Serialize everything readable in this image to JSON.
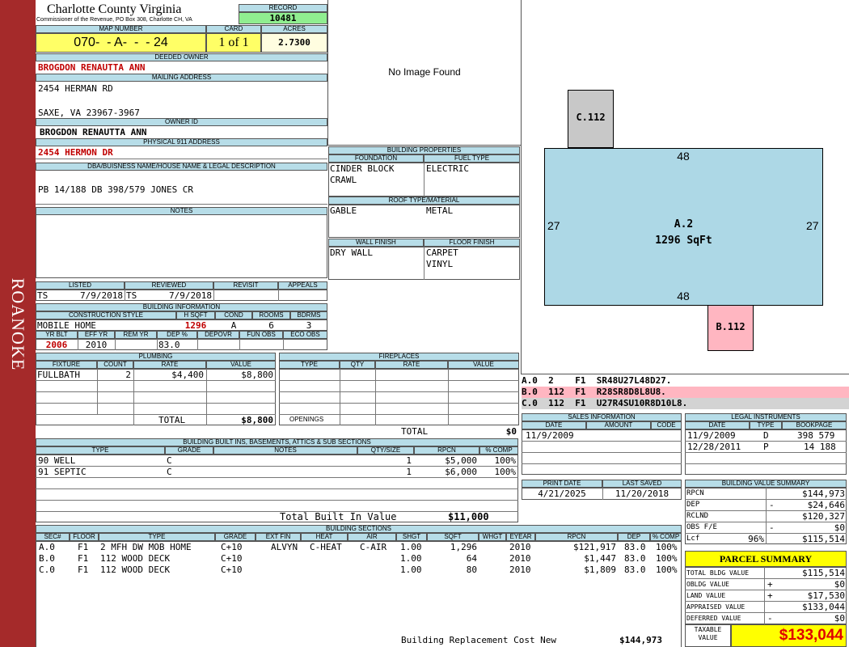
{
  "sidebar": {
    "label": "ROANOKE",
    "color": "#a52a2a"
  },
  "header": {
    "county": "Charlotte County Virginia",
    "commissioner": "Commissioner of the Revenue, PO Box 308, Charlotte CH, VA",
    "record_label": "RECORD",
    "record": "10481",
    "map_number_label": "MAP NUMBER",
    "map_number": "070-  - A-  -  - 24",
    "card_label": "CARD",
    "card": "1 of 1",
    "acres_label": "ACRES",
    "acres": "2.7300"
  },
  "owner": {
    "deeded_label": "DEEDED OWNER",
    "deeded": "BROGDON RENAUTTA ANN",
    "mailing_label": "MAILING ADDRESS",
    "mailing1": "2454 HERMAN RD",
    "mailing2": "SAXE, VA 23967-3967",
    "owner_id_label": "OWNER ID",
    "owner_id": "BROGDON RENAUTTA ANN",
    "physical_label": "PHYSICAL 911 ADDRESS",
    "physical": "2454 HERMON DR",
    "dba_label": "DBA/BUISNESS NAME/HOUSE NAME & LEGAL DESCRIPTION",
    "legal": "PB 14/188 DB 398/579 JONES CR",
    "notes_label": "NOTES"
  },
  "photo": {
    "text": "No Image Found"
  },
  "listing": {
    "listed_label": "LISTED",
    "reviewed_label": "REVIEWED",
    "revisit_label": "REVISIT",
    "appeals_label": "APPEALS",
    "listed_by": "TS",
    "listed_date": "7/9/2018",
    "reviewed_by": "TS",
    "reviewed_date": "7/9/2018"
  },
  "building_info": {
    "label": "BUILDING INFORMATION",
    "style_label": "CONSTRUCTION STYLE",
    "hsqft_label": "H SQFT",
    "cond_label": "COND",
    "rooms_label": "ROOMS",
    "bdrms_label": "BDRMS",
    "style": "MOBILE HOME",
    "hsqft": "1296",
    "cond": "A",
    "rooms": "6",
    "bdrms": "3",
    "yrblt_label": "YR BLT",
    "effyr_label": "EFF YR",
    "remyr_label": "REM YR",
    "dep_label": "DEP %",
    "depovr_label": "DEPOVR",
    "funobs_label": "FUN OBS",
    "ecoobs_label": "ECO OBS",
    "yrblt": "2006",
    "effyr": "2010",
    "dep": "83.0"
  },
  "properties": {
    "label": "BUILDING PROPERTIES",
    "foundation_label": "FOUNDATION",
    "fuel_label": "FUEL TYPE",
    "foundation1": "CINDER BLOCK",
    "foundation2": "CRAWL",
    "fuel": "ELECTRIC",
    "roof_label": "ROOF TYPE/MATERIAL",
    "roof_type": "GABLE",
    "roof_material": "METAL",
    "wall_label": "WALL FINISH",
    "floor_label": "FLOOR FINISH",
    "wall": "DRY WALL",
    "floor1": "CARPET",
    "floor2": "VINYL"
  },
  "plumbing": {
    "label": "PLUMBING",
    "headers": [
      "FIXTURE",
      "COUNT",
      "RATE",
      "VALUE"
    ],
    "rows": [
      {
        "fixture": "FULLBATH",
        "count": "2",
        "rate": "$4,400",
        "value": "$8,800"
      }
    ],
    "total_label": "TOTAL",
    "total": "$8,800"
  },
  "fireplaces": {
    "label": "FIREPLACES",
    "headers": [
      "TYPE",
      "QTY",
      "RATE",
      "VALUE"
    ],
    "openings_label": "OPENINGS",
    "total_label": "TOTAL",
    "total": "$0"
  },
  "builtins": {
    "label": "BUILDING BUILT INS, BASEMENTS, ATTICS & SUB SECTIONS",
    "headers": [
      "TYPE",
      "GRADE",
      "NOTES",
      "QTY/SIZE",
      "RPCN",
      "% COMP"
    ],
    "rows": [
      {
        "type": "90 WELL",
        "grade": "C",
        "notes": "",
        "qty": "1",
        "rpcn": "$5,000",
        "comp": "100%"
      },
      {
        "type": "91 SEPTIC",
        "grade": "C",
        "notes": "",
        "qty": "1",
        "rpcn": "$6,000",
        "comp": "100%"
      }
    ],
    "total_label": "Total Built In Value",
    "total": "$11,000"
  },
  "sections": {
    "label": "BUILDING SECTIONS",
    "headers": [
      "SEC#",
      "FLOOR",
      "TYPE",
      "GRADE",
      "EXT FIN",
      "HEAT",
      "AIR",
      "SHGT",
      "SQFT",
      "WHGT",
      "EYEAR",
      "RPCN",
      "DEP",
      "% COMP"
    ],
    "rows": [
      {
        "sec": "A.0",
        "floor": "F1",
        "type": "2 MFH DW MOB HOME",
        "grade": "C+10",
        "ext": "ALVYN",
        "heat": "C-HEAT",
        "air": "C-AIR",
        "shgt": "1.00",
        "sqft": "1,296",
        "whgt": "",
        "eyear": "2010",
        "rpcn": "$121,917",
        "dep": "83.0",
        "comp": "100%"
      },
      {
        "sec": "B.0",
        "floor": "F1",
        "type": "112 WOOD DECK",
        "grade": "C+10",
        "ext": "",
        "heat": "",
        "air": "",
        "shgt": "1.00",
        "sqft": "64",
        "whgt": "",
        "eyear": "2010",
        "rpcn": "$1,447",
        "dep": "83.0",
        "comp": "100%"
      },
      {
        "sec": "C.0",
        "floor": "F1",
        "type": "112 WOOD DECK",
        "grade": "C+10",
        "ext": "",
        "heat": "",
        "air": "",
        "shgt": "1.00",
        "sqft": "80",
        "whgt": "",
        "eyear": "2010",
        "rpcn": "$1,809",
        "dep": "83.0",
        "comp": "100%"
      }
    ],
    "rcn_label": "Building Replacement Cost New",
    "rcn": "$144,973"
  },
  "sketch": {
    "main_label": "A.2",
    "main_area": "1296 SqFt",
    "top": "48",
    "bottom": "48",
    "left": "27",
    "right": "27",
    "c_label": "C.112",
    "b_label": "B.112",
    "main_color": "#add8e6",
    "deck_c_color": "#c8c8c8",
    "deck_b_color": "#ffb6c1"
  },
  "vectors": [
    {
      "text": "A.0  2    F1  SR48U27L48D27.",
      "color": "#ffffff"
    },
    {
      "text": "B.0  112  F1  R28SR8D8L8U8.",
      "color": "#ffb6c1"
    },
    {
      "text": "C.0  112  F1  U27R4SU10R8D10L8.",
      "color": "#d3d3d3"
    }
  ],
  "sales": {
    "label": "SALES INFORMATION",
    "headers": [
      "DATE",
      "AMOUNT",
      "CODE"
    ],
    "rows": [
      {
        "date": "11/9/2009",
        "amount": "",
        "code": ""
      }
    ]
  },
  "legal_instr": {
    "label": "LEGAL INSTRUMENTS",
    "headers": [
      "DATE",
      "TYPE",
      "BOOKPAGE"
    ],
    "rows": [
      {
        "date": "11/9/2009",
        "type": "D",
        "book": "398 579"
      },
      {
        "date": "12/28/2011",
        "type": "P",
        "book": "14 188"
      }
    ]
  },
  "dates": {
    "print_label": "PRINT DATE",
    "saved_label": "LAST SAVED",
    "print": "4/21/2025",
    "saved": "11/20/2018"
  },
  "value_summary": {
    "label": "BUILDING VALUE SUMMARY",
    "rpcn_label": "RPCN",
    "rpcn": "$144,973",
    "dep_label": "DEP",
    "dep_sign": "-",
    "dep": "$24,646",
    "rclnd_label": "RCLND",
    "rclnd": "$120,327",
    "obs_label": "OBS F/E",
    "obs_sign": "-",
    "obs": "$0",
    "lcf_label": "Lcf",
    "lcf_pct": "96%",
    "lcf": "$115,514"
  },
  "parcel": {
    "label": "PARCEL SUMMARY",
    "bldg_label": "TOTAL BLDG VALUE",
    "bldg": "$115,514",
    "obldg_label": "OBLDG VALUE",
    "obldg_sign": "+",
    "obldg": "$0",
    "land_label": "LAND VALUE",
    "land_sign": "+",
    "land": "$17,530",
    "appraised_label": "APPRAISED VALUE",
    "appraised": "$133,044",
    "deferred_label": "DEFERRED VALUE",
    "deferred_sign": "-",
    "deferred": "$0",
    "taxable_label1": "TAXABLE",
    "taxable_label2": "VALUE",
    "taxable": "$133,044"
  }
}
